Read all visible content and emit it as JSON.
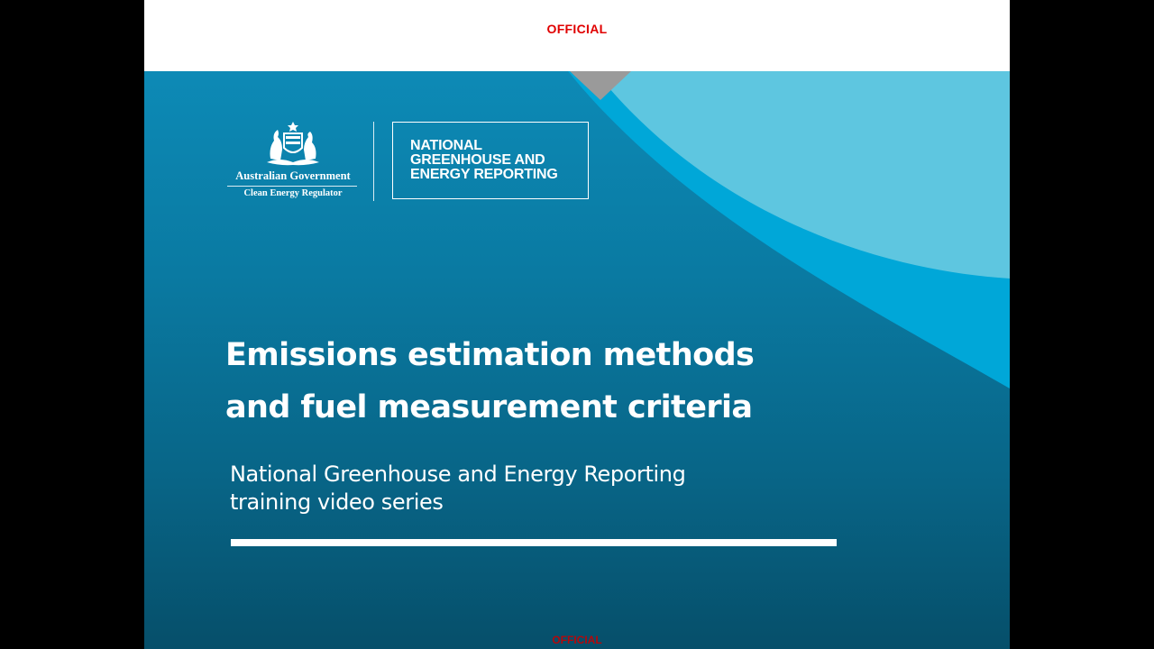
{
  "header": {
    "classification_top": "OFFICIAL"
  },
  "logo": {
    "government_name": "Australian Government",
    "agency_name": "Clean Energy Regulator",
    "crest_icon": "commonwealth-coat-of-arms-icon"
  },
  "program_box": {
    "lines": [
      "NATIONAL",
      "GREENHOUSE AND",
      "ENERGY REPORTING"
    ]
  },
  "title": {
    "lines": [
      "Emissions estimation methods",
      "and fuel measurement criteria"
    ]
  },
  "subtitle": {
    "lines": [
      "National Greenhouse and Energy Reporting",
      "training video series"
    ]
  },
  "footer": {
    "classification_bottom": "OFFICIAL"
  },
  "colors": {
    "classification_red": "#e00000",
    "panel_blue": "#0a7aa2",
    "light_curve": "#5ec6e0",
    "mid_curve": "#00a7d8",
    "grey_notch": "#9a9a9a"
  }
}
